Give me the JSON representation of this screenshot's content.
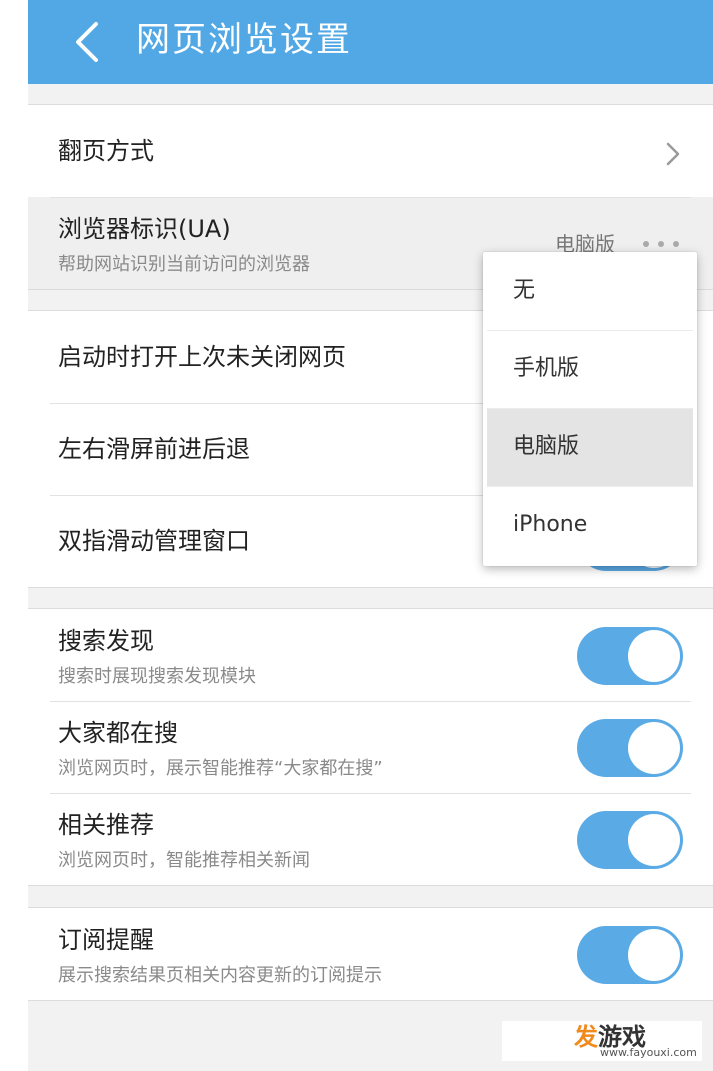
{
  "header": {
    "title": "网页浏览设置"
  },
  "group1": {
    "page_turn_label": "翻页方式",
    "ua_label": "浏览器标识(UA)",
    "ua_sub": "帮助网站识别当前访问的浏览器",
    "ua_value": "电脑版"
  },
  "group2": {
    "restore_label": "启动时打开上次未关闭网页",
    "swipe_label": "左右滑屏前进后退",
    "two_finger_label": "双指滑动管理窗口"
  },
  "group3": {
    "items": [
      {
        "label": "搜索发现",
        "sub": "搜索时展现搜索发现模块",
        "on": true
      },
      {
        "label": "大家都在搜",
        "sub": "浏览网页时，展示智能推荐“大家都在搜”",
        "on": true
      },
      {
        "label": "相关推荐",
        "sub": "浏览网页时，智能推荐相关新闻",
        "on": true
      }
    ]
  },
  "group4": {
    "items": [
      {
        "label": "订阅提醒",
        "sub": "展示搜索结果页相关内容更新的订阅提示",
        "on": true
      }
    ]
  },
  "ua_dropdown": {
    "options": [
      "无",
      "手机版",
      "电脑版",
      "iPhone"
    ],
    "selected": "电脑版"
  },
  "watermark": {
    "text_accent": "发",
    "text_rest": "游戏",
    "url": "www.fayouxi.com"
  },
  "colors": {
    "header": "#52a8e4",
    "toggle_on": "#5aaae5",
    "background": "#f2f2f2"
  },
  "icons": {
    "back": "chevron-left-icon",
    "arrow": "chevron-right-icon",
    "more": "more-dots-icon"
  }
}
